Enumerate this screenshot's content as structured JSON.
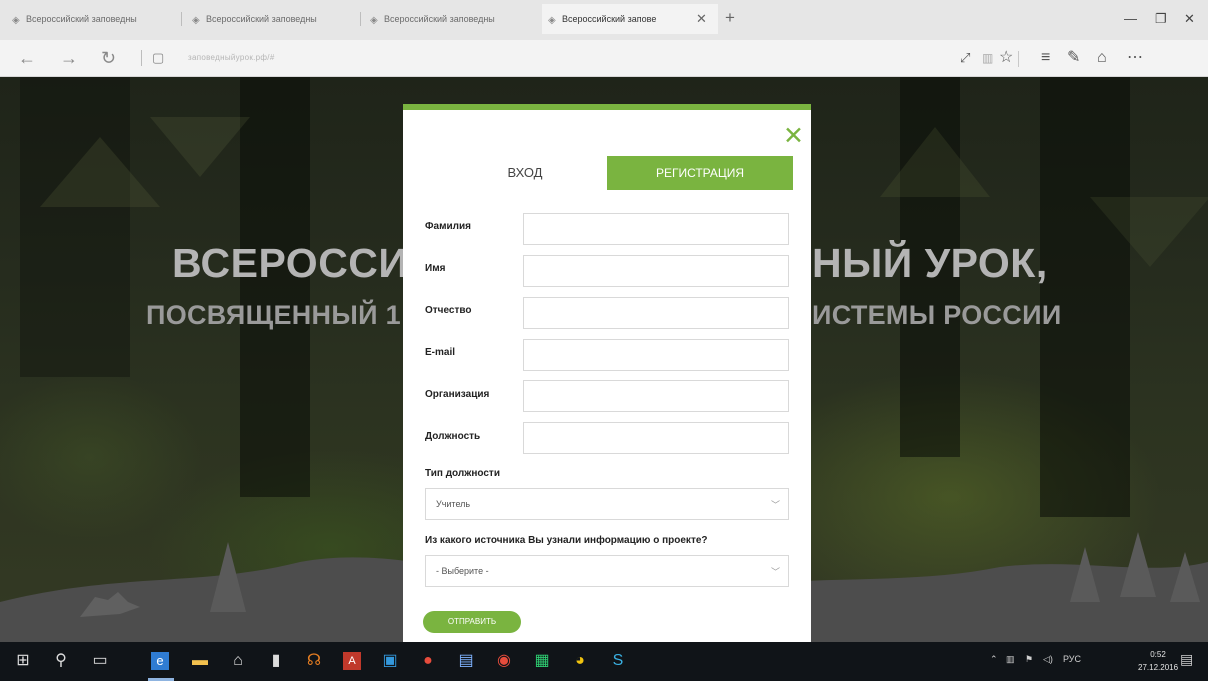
{
  "browser": {
    "tabs": [
      {
        "title": "Всероссийский заповедны",
        "active": false
      },
      {
        "title": "Всероссийский заповедны",
        "active": false
      },
      {
        "title": "Всероссийский заповедны",
        "active": false
      },
      {
        "title": "Всероссийский заповe",
        "active": true
      }
    ],
    "url": "заповедныйурок.рф/#"
  },
  "page": {
    "title_left": "ВСЕРОССИ",
    "title_right": "НЫЙ УРОК,",
    "subtitle_left": "ПОСВЯЩЕННЫЙ 1",
    "subtitle_right": "ИСТЕМЫ РОССИИ"
  },
  "modal": {
    "tab_login": "ВХОД",
    "tab_register": "РЕГИСТРАЦИЯ",
    "fields": [
      {
        "label": "Фамилия",
        "value": ""
      },
      {
        "label": "Имя",
        "value": ""
      },
      {
        "label": "Отчество",
        "value": ""
      },
      {
        "label": "E-mail",
        "value": ""
      },
      {
        "label": "Организация",
        "value": ""
      },
      {
        "label": "Должность",
        "value": ""
      }
    ],
    "position_type": {
      "label": "Тип должности",
      "value": "Учитель"
    },
    "source": {
      "label": "Из какого источника Вы узнали информацию о проекте?",
      "value": "- Выберите -"
    },
    "submit_label": "ОТПРАВИТЬ"
  },
  "taskbar": {
    "language": "РУС",
    "time": "0:52",
    "date": "27.12.2016"
  },
  "colors": {
    "accent": "#7ab440",
    "taskbar": "#101418"
  }
}
